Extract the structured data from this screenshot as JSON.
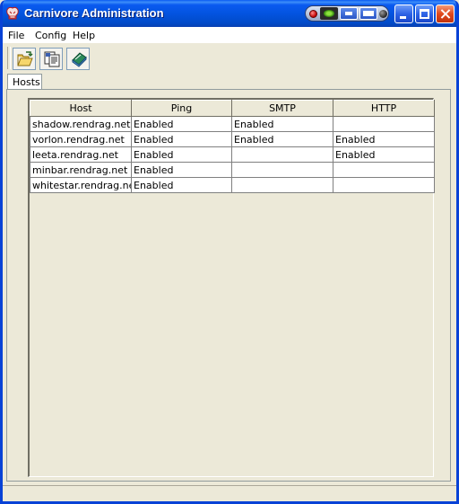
{
  "window": {
    "title": "Carnivore Administration"
  },
  "menu": {
    "file": "File",
    "config": "Config",
    "help": "Help"
  },
  "toolbar": {
    "icons": [
      "open-folder-icon",
      "properties-icon",
      "book-icon"
    ]
  },
  "tabs": [
    {
      "label": "Hosts",
      "selected": true
    }
  ],
  "table": {
    "columns": [
      "Host",
      "Ping",
      "SMTP",
      "HTTP"
    ],
    "rows": [
      {
        "host": "shadow.rendrag.net",
        "ping": "Enabled",
        "smtp": "Enabled",
        "http": ""
      },
      {
        "host": "vorlon.rendrag.net",
        "ping": "Enabled",
        "smtp": "Enabled",
        "http": "Enabled"
      },
      {
        "host": "leeta.rendrag.net",
        "ping": "Enabled",
        "smtp": "",
        "http": "Enabled"
      },
      {
        "host": "minbar.rendrag.net",
        "ping": "Enabled",
        "smtp": "",
        "http": ""
      },
      {
        "host": "whitestar.rendrag.net",
        "ping": "Enabled",
        "smtp": "",
        "http": ""
      }
    ]
  },
  "colors": {
    "titlebar": "#0354e0",
    "window_bg": "#ece9d8",
    "close_button": "#e0481c"
  }
}
